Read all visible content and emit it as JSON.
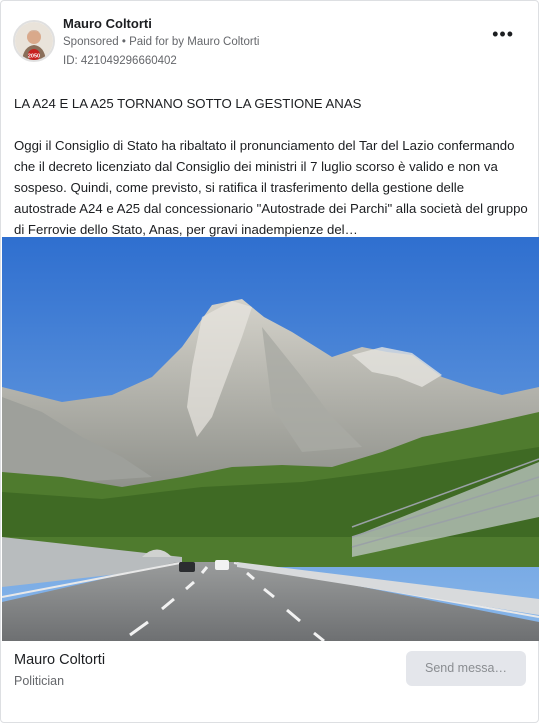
{
  "ad": {
    "page_name": "Mauro Coltorti",
    "sponsored_label": "Sponsored",
    "separator": "•",
    "paid_for_prefix": "Paid for by",
    "paid_for_name": "Mauro Coltorti",
    "ad_id": "ID: 421049296660402",
    "more_icon": "more-options-icon",
    "avatar_badge": "2050"
  },
  "post": {
    "title": "LA A24 E LA A25 TORNANO SOTTO LA GESTIONE ANAS",
    "body": "Oggi il Consiglio di Stato ha ribaltato il pronunciamento del Tar del Lazio confermando che il decreto licenziato dal Consiglio dei ministri il 7 luglio scorso è valido e non va sospeso. Quindi, come previsto, si ratifica il trasferimento della gestione delle autostrade A24 e A25 dal concessionario \"Autostrade dei Parchi\" alla società del gruppo di Ferrovie dello Stato, Anas, per gravi inadempienze del…"
  },
  "footer": {
    "name": "Mauro Coltorti",
    "category": "Politician",
    "cta_label": "Send messa…"
  },
  "colors": {
    "sky": "#3f7fd6",
    "mountain": "#b9b8b0",
    "grass": "#4c7a2c",
    "road": "#7b7d7f",
    "cta_bg": "#e4e6eb"
  }
}
